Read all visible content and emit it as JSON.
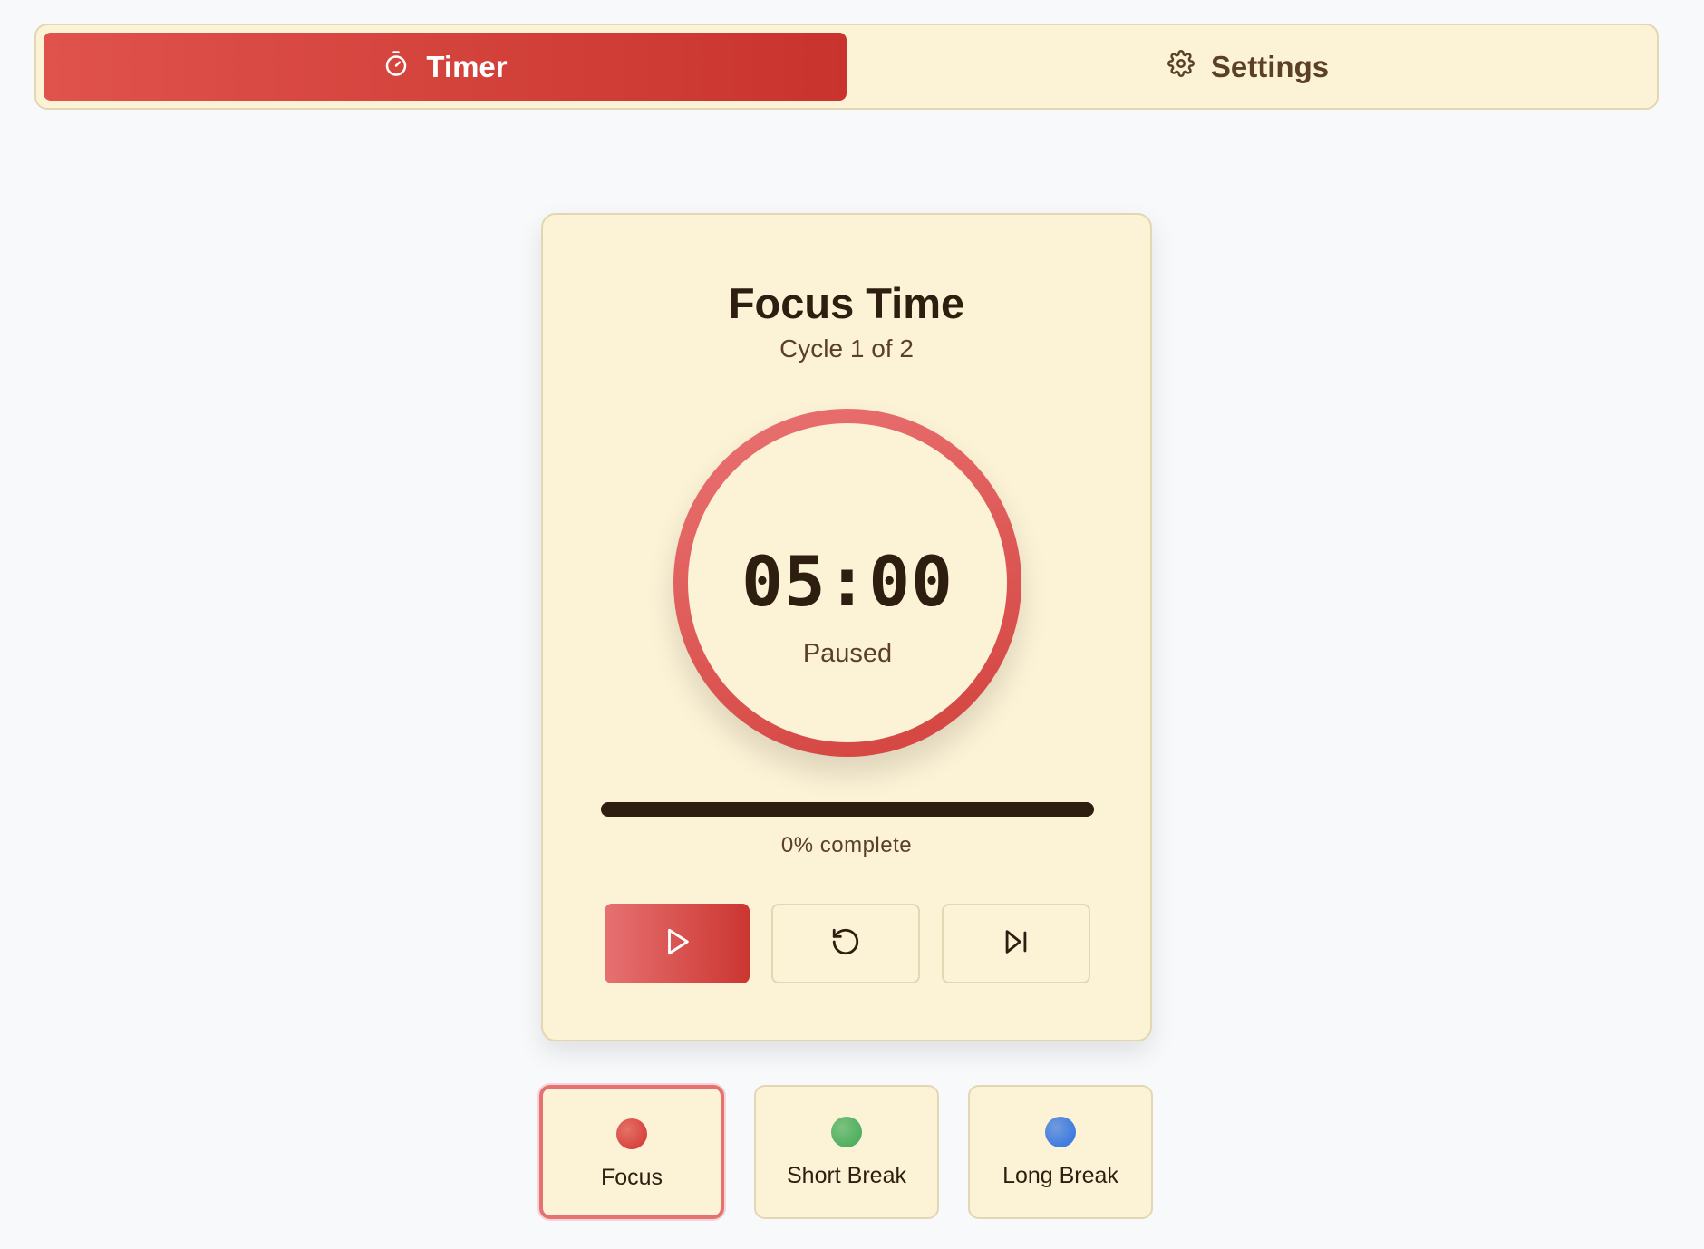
{
  "tabs": [
    {
      "label": "Timer",
      "icon": "stopwatch-icon",
      "active": true
    },
    {
      "label": "Settings",
      "icon": "gear-icon",
      "active": false
    }
  ],
  "card": {
    "title": "Focus Time",
    "cycle_text": "Cycle 1 of 2",
    "time": "05:00",
    "status": "Paused",
    "progress_percent": 0,
    "progress_label": "0% complete"
  },
  "controls": [
    {
      "name": "play",
      "icon": "play-icon"
    },
    {
      "name": "reset",
      "icon": "reset-icon"
    },
    {
      "name": "skip",
      "icon": "skip-forward-icon"
    }
  ],
  "modes": [
    {
      "label": "Focus",
      "color": "#d9443f",
      "selected": true
    },
    {
      "label": "Short Break",
      "color": "#4fb060",
      "selected": false
    },
    {
      "label": "Long Break",
      "color": "#3f7be0",
      "selected": false
    }
  ],
  "colors": {
    "accent": "#d2423d",
    "card_bg": "#fcf2d6",
    "text_dark": "#2d1e0f"
  }
}
